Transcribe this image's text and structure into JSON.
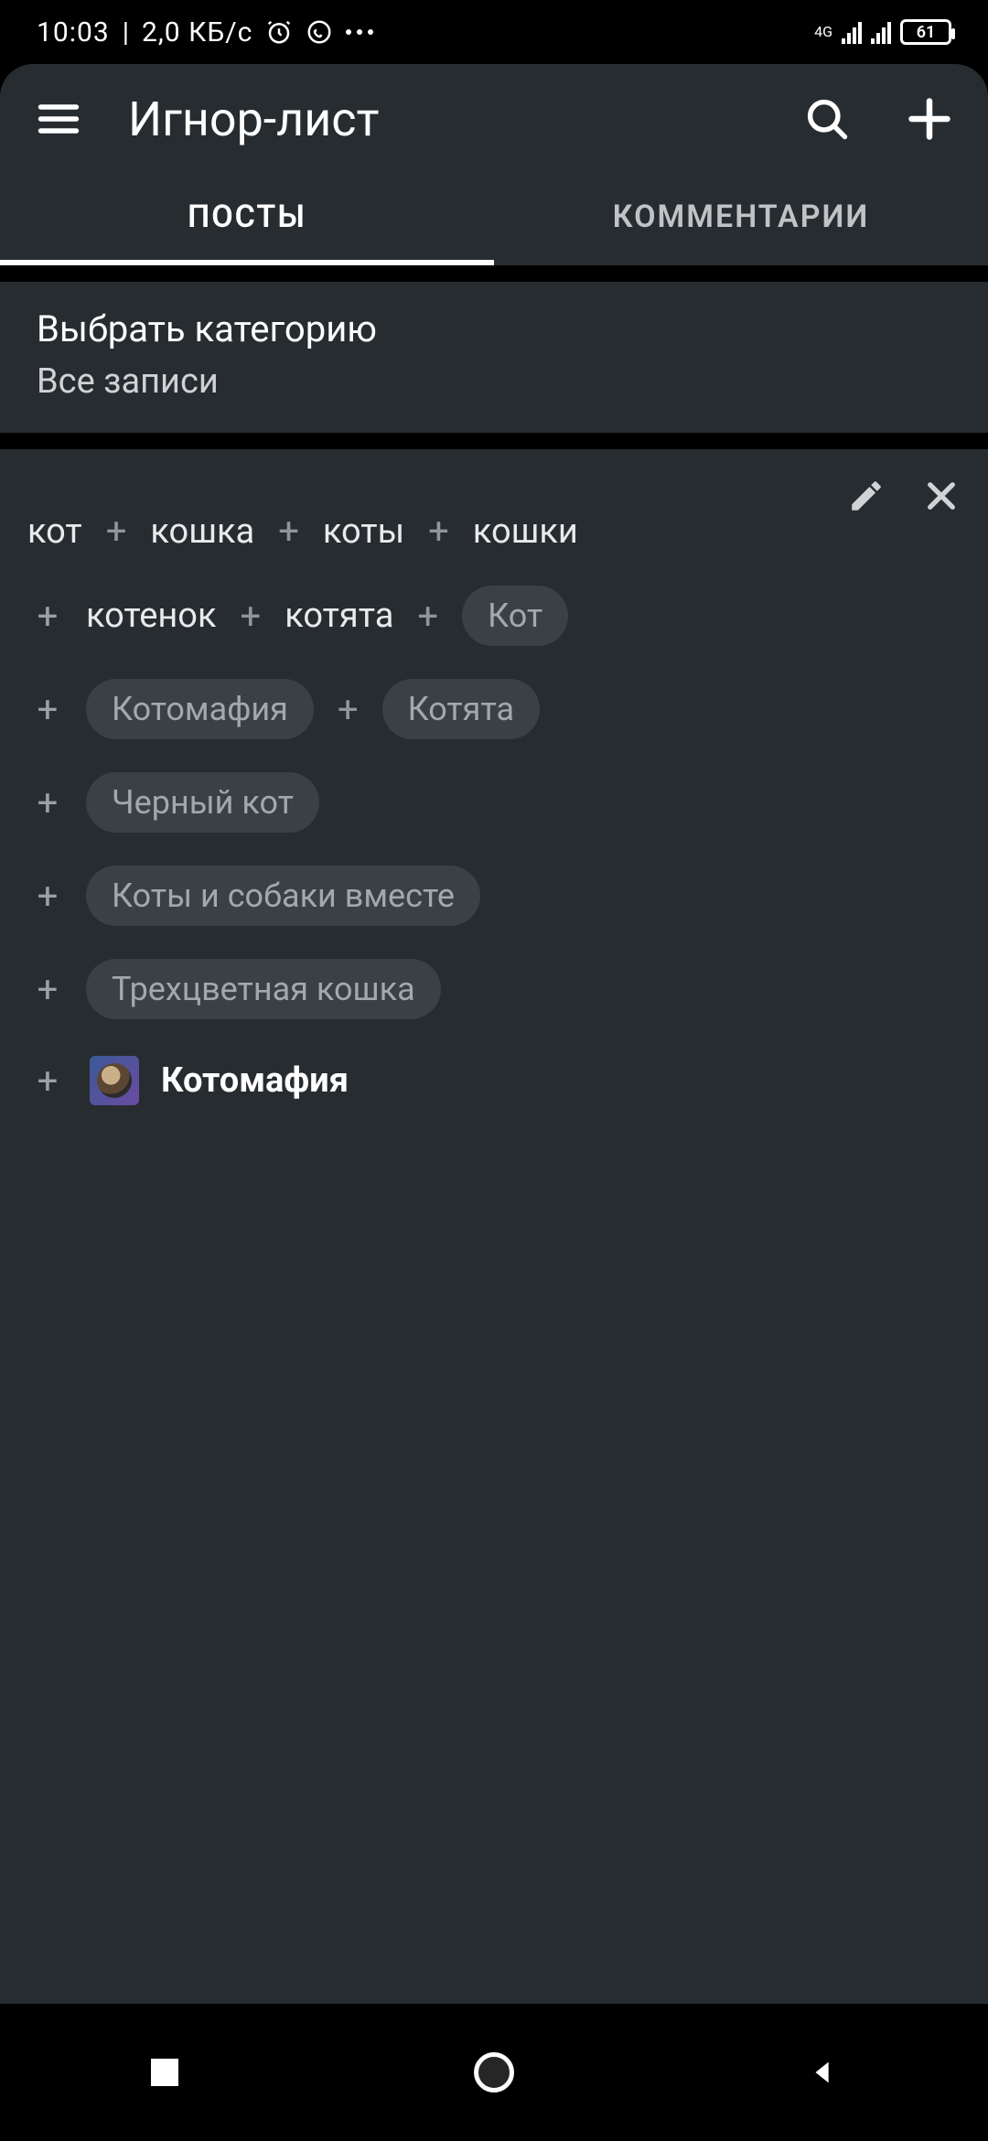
{
  "status": {
    "time": "10:03",
    "speed": "2,0 КБ/с",
    "network_label": "4G",
    "battery": "61"
  },
  "toolbar": {
    "title": "Игнор-лист"
  },
  "tabs": {
    "posts": "ПОСТЫ",
    "comments": "КОММЕНТАРИИ"
  },
  "category": {
    "label": "Выбрать категорию",
    "value": "Все записи"
  },
  "rule": {
    "row1": [
      "кот",
      "кошка",
      "коты",
      "кошки"
    ],
    "row2_text": [
      "котенок",
      "котята"
    ],
    "row2_chip": "Кот",
    "row3_chips": [
      "Котомафия",
      "Котята"
    ],
    "row4_chip": "Черный кот",
    "row5_chip": "Коты и собаки вместе",
    "row6_chip": "Трехцветная кошка",
    "community": "Котомафия"
  }
}
